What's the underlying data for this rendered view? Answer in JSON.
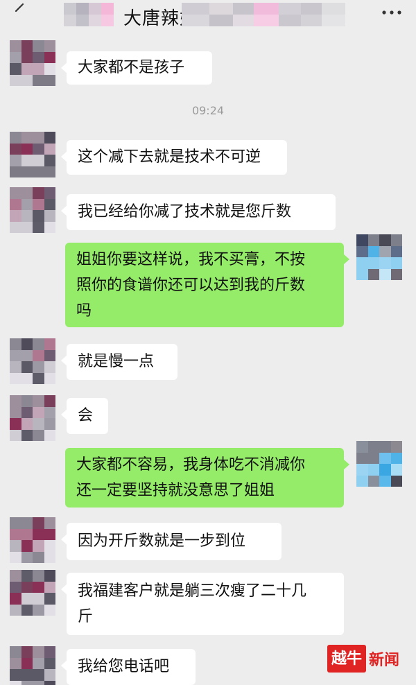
{
  "header": {
    "title_visible": "大唐辣妹",
    "back_icon": "back-arrow-icon",
    "more_icon": "more-dots-icon"
  },
  "timestamp": "09:24",
  "messages": [
    {
      "side": "in",
      "text": "大家都不是孩子"
    },
    {
      "side": "in",
      "text": "这个减下去就是技术不可逆"
    },
    {
      "side": "in",
      "text": "我已经给你减了技术就是您斤数"
    },
    {
      "side": "out",
      "lines": [
        "姐姐你要这样说，我不买膏，不按",
        "照你的食谱你还可以达到我的斤数",
        "吗"
      ]
    },
    {
      "side": "in",
      "text": "就是慢一点"
    },
    {
      "side": "in",
      "text": "会"
    },
    {
      "side": "out",
      "lines": [
        "大家都不容易，我身体吃不消减你",
        "还一定要坚持就没意思了姐姐"
      ]
    },
    {
      "side": "in",
      "text": "因为开斤数就是一步到位"
    },
    {
      "side": "in",
      "lines": [
        "我福建客户就是躺三次瘦了二十几",
        "斤"
      ]
    },
    {
      "side": "in",
      "text": "我给您电话吧"
    }
  ],
  "watermark": {
    "mark": "越牛",
    "text": "新闻",
    "color": "#e02424"
  },
  "colors": {
    "background": "#ededed",
    "incoming_bubble": "#ffffff",
    "outgoing_bubble": "#95ec69"
  }
}
